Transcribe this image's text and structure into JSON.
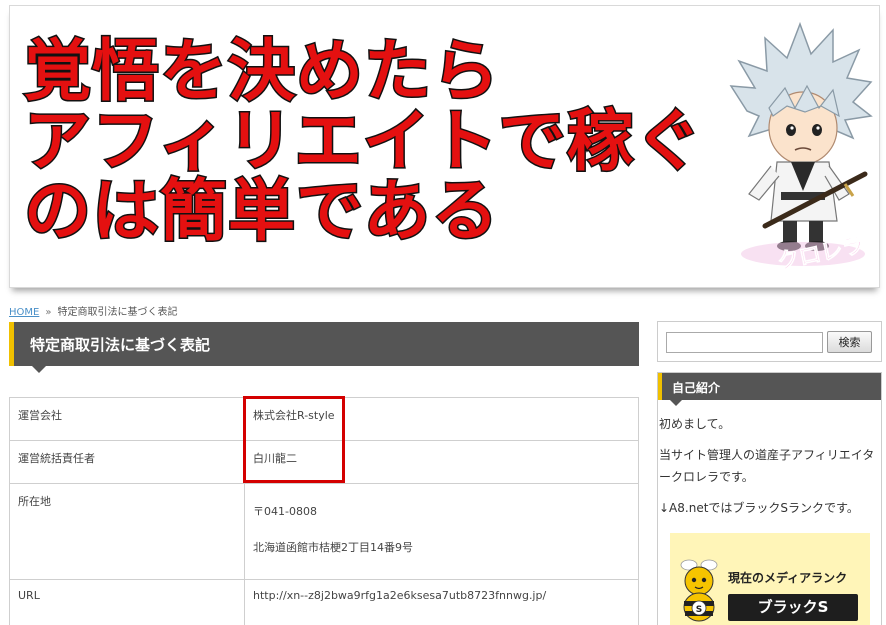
{
  "banner": {
    "line1": "覚悟を決めたら",
    "line2": "アフィリエイトで稼ぐ",
    "line3": "のは簡単である",
    "mascot_label": "クロレラ",
    "text_color": "#e41010"
  },
  "breadcrumb": {
    "home": "HOME",
    "separator": "»",
    "current": "特定商取引法に基づく表記"
  },
  "page": {
    "title": "特定商取引法に基づく表記",
    "accent": "#f0c000"
  },
  "table": {
    "rows": [
      {
        "label": "運営会社",
        "value": "株式会社R-style"
      },
      {
        "label": "運営統括責任者",
        "value": "白川龍二"
      },
      {
        "label": "所在地",
        "value_lines": [
          "〒041-0808",
          "北海道函館市桔梗2丁目14番9号"
        ]
      },
      {
        "label": "URL",
        "value": "http://xn--z8j2bwa9rfg1a2e6ksesa7utb8723fnnwg.jp/"
      }
    ]
  },
  "sidebar": {
    "search": {
      "placeholder": "",
      "button_label": "検索"
    },
    "profile": {
      "heading": "自己紹介",
      "greeting": "初めまして。",
      "description": "当サイト管理人の道産子アフィリエイタークロレラです。",
      "rank_note": "↓A8.netではブラックSランクです。",
      "badge_title": "現在のメディアランク",
      "badge_rank": "ブラックS"
    }
  }
}
